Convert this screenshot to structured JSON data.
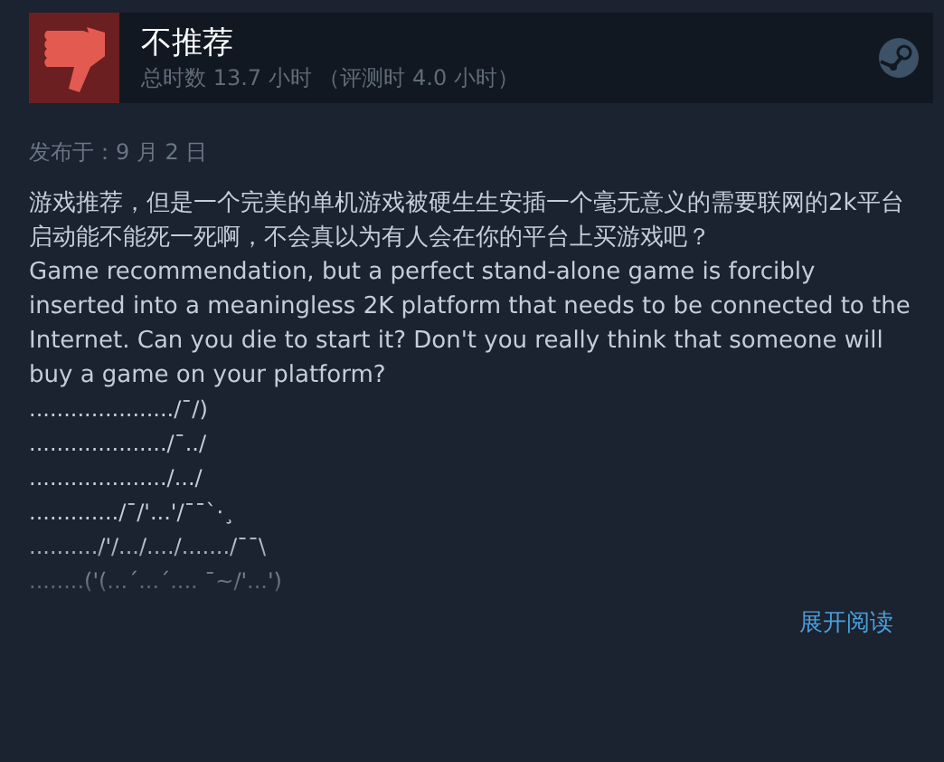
{
  "review": {
    "verdict": "不推荐",
    "recommended": false,
    "playtime": "总时数 13.7 小时",
    "review_time": "（评测时 4.0 小时）",
    "posted": "发布于：9 月 2 日",
    "paragraphs": [
      "游戏推荐，但是一个完美的单机游戏被硬生生安插一个毫无意义的需要联网的2k平台启动能不能死一死啊，不会真以为有人会在你的平台上买游戏吧？",
      "Game recommendation, but a perfect stand-alone game is forcibly inserted into a meaningless 2K platform that needs to be connected to the Internet. Can you die to start it? Don't you really think that someone will buy a game on your platform?"
    ],
    "art_lines": [
      "...................../¯/)",
      "..................../¯../",
      "..................../.../",
      "............./¯/'...'/¯¯`·¸",
      "........../'/.../..../......./¯¯\\",
      "........('(...´...´.... ¯~/'...')"
    ],
    "expand_link": "展开阅读"
  }
}
